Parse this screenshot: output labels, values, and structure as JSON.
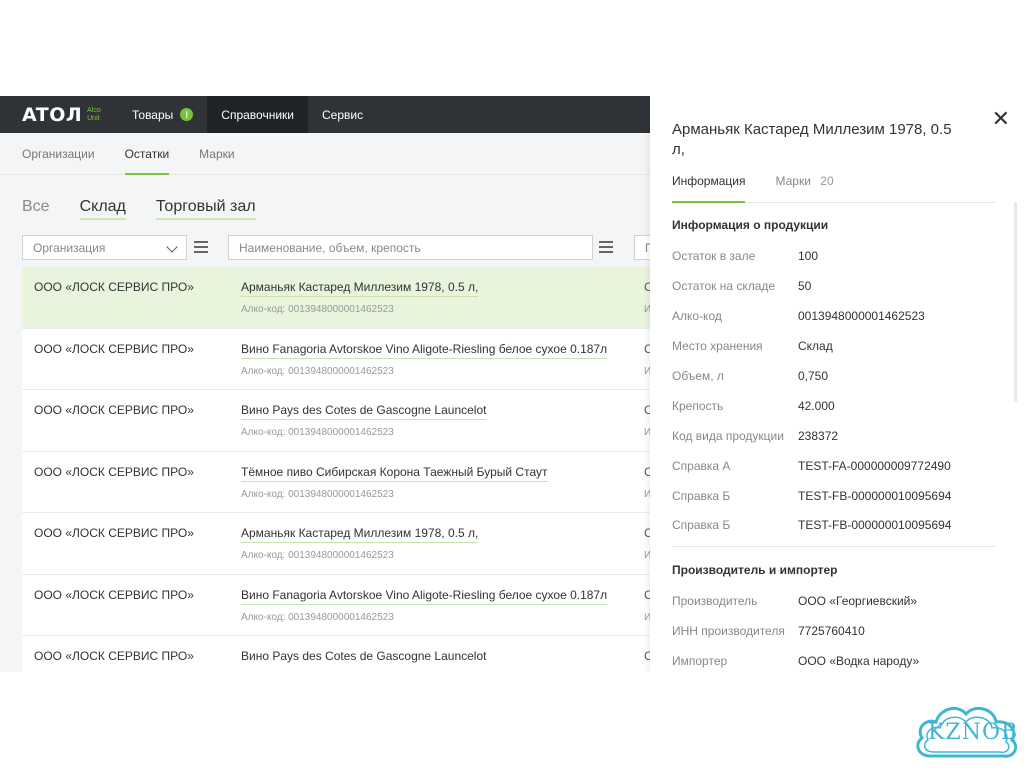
{
  "app": {
    "logo": {
      "word": "ATOЛ",
      "sub_line1": "Alco",
      "sub_line2": "Unit"
    },
    "topnav": [
      {
        "label": "Товары",
        "badge": "!"
      },
      {
        "label": "Справочники",
        "active": true
      },
      {
        "label": "Сервис"
      }
    ],
    "subnav": [
      {
        "label": "Организации"
      },
      {
        "label": "Остатки",
        "active": true
      },
      {
        "label": "Марки"
      }
    ],
    "filter_tabs": [
      "Все",
      "Склад",
      "Торговый зал"
    ],
    "filters": {
      "org_select": "Организация",
      "search_placeholder": "Наименование, объем, крепость",
      "third_truncated": "П"
    },
    "rows": [
      {
        "org": "ООО «ЛОСК СЕРВИС ПРО»",
        "name": "Арманьяк Кастаред Миллезим 1978, 0.5 л,",
        "code": "Алко-код: 0013948000001462523",
        "trunc": "С",
        "trunc2": "И",
        "selected": true
      },
      {
        "org": "ООО «ЛОСК СЕРВИС ПРО»",
        "name": "Вино Fanagoria Avtorskoe Vino Aligote-Riesling белое сухое 0.187л",
        "code": "Алко-код: 0013948000001462523",
        "trunc": "С",
        "trunc2": "И"
      },
      {
        "org": "ООО «ЛОСК СЕРВИС ПРО»",
        "name": "Вино Pays des Cotes de Gascogne Launcelot",
        "code": "Алко-код: 0013948000001462523",
        "trunc": "С",
        "trunc2": "И"
      },
      {
        "org": "ООО «ЛОСК СЕРВИС ПРО»",
        "name": "Тёмное пиво Сибирская Корона Таежный Бурый Стаут",
        "code": "Алко-код: 0013948000001462523",
        "trunc": "С",
        "trunc2": "И"
      },
      {
        "org": "ООО «ЛОСК СЕРВИС ПРО»",
        "name": "Арманьяк Кастаред Миллезим 1978, 0.5 л,",
        "code": "Алко-код: 0013948000001462523",
        "trunc": "С",
        "trunc2": "И"
      },
      {
        "org": "ООО «ЛОСК СЕРВИС ПРО»",
        "name": "Вино Fanagoria Avtorskoe Vino Aligote-Riesling белое сухое 0.187л",
        "code": "Алко-код: 0013948000001462523",
        "trunc": "С",
        "trunc2": "И"
      },
      {
        "org": "ООО «ЛОСК СЕРВИС ПРО»",
        "name": "Вино Pays des Cotes de Gascogne Launcelot",
        "code": "",
        "trunc": "С",
        "trunc2": ""
      }
    ]
  },
  "panel": {
    "title": "Арманьяк Кастаред Миллезим 1978, 0.5 л,",
    "tabs": [
      {
        "label": "Информация",
        "count": ""
      },
      {
        "label": "Марки",
        "count": "20"
      }
    ],
    "product_section": "Информация о продукции",
    "product_info": [
      {
        "key": "Остаток в зале",
        "value": "100"
      },
      {
        "key": "Остаток на складе",
        "value": "50"
      },
      {
        "key": "Алко-код",
        "value": "0013948000001462523"
      },
      {
        "key": "Место хранения",
        "value": "Склад"
      },
      {
        "key": "Объем, л",
        "value": "0,750"
      },
      {
        "key": "Крепость",
        "value": "42.000"
      },
      {
        "key": "Код вида продукции",
        "value": "238372"
      },
      {
        "key": "Справка А",
        "value": "TEST-FA-000000009772490"
      },
      {
        "key": "Справка Б",
        "value": "TEST-FB-000000010095694"
      },
      {
        "key": "Справка Б",
        "value": "TEST-FB-000000010095694"
      }
    ],
    "maker_section": "Производитель и импортер",
    "maker_info": [
      {
        "key": "Производитель",
        "value": "ООО «Георгиевский»"
      },
      {
        "key": "ИНН производителя",
        "value": "7725760410"
      },
      {
        "key": "Импортер",
        "value": "ООО «Водка народу»"
      }
    ]
  },
  "watermark": {
    "text": "KZNOB"
  },
  "colors": {
    "accent": "#7bc142",
    "topbar": "#2f3337",
    "selected_row": "#e8f5dc"
  }
}
